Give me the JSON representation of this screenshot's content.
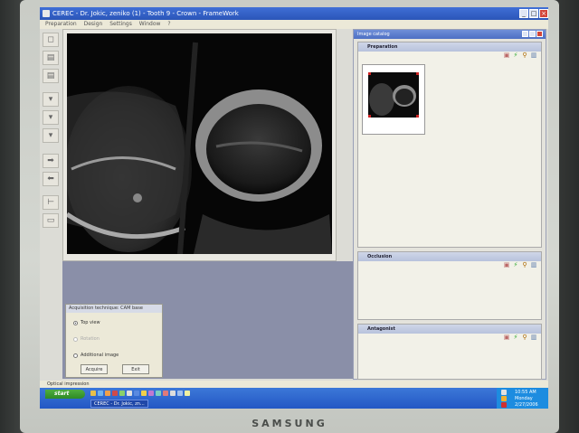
{
  "window": {
    "title": "CEREC - Dr. Jokic, zeniko (1) - Tooth  9 - Crown - FrameWork",
    "menu": [
      "Preparation",
      "Design",
      "Settings",
      "Window",
      "?"
    ]
  },
  "catalog": {
    "title": "Image catalog",
    "sections": [
      {
        "label": "Preparation"
      },
      {
        "label": "Occlusion"
      },
      {
        "label": "Antagonist"
      }
    ]
  },
  "acquisition": {
    "title": "Acquisition technique: CAM base",
    "options": [
      {
        "label": "Top view",
        "selected": true,
        "enabled": true
      },
      {
        "label": "Rotation",
        "selected": false,
        "enabled": false
      },
      {
        "label": "Additional image",
        "selected": false,
        "enabled": true
      }
    ],
    "acquire_label": "Acquire",
    "exit_label": "Exit"
  },
  "status": {
    "text": "Optical impression"
  },
  "taskbar": {
    "start_label": "start",
    "task_label": "CEREC - Dr. Jokic, zn...",
    "clock": "10:55 AM",
    "day": "Monday",
    "date": "2/27/2006"
  },
  "monitor": {
    "brand": "SAMSUNG"
  },
  "colors": {
    "titlebar": "#2b55b8",
    "catalog_title": "#4d6fc4",
    "close": "#d2463a",
    "start": "#2e8a25"
  }
}
